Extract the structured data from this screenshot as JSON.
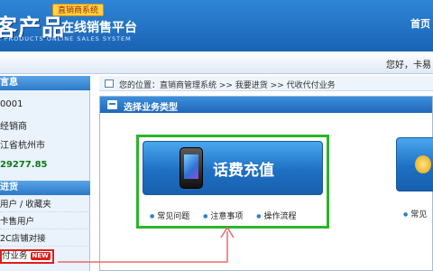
{
  "header": {
    "logo_big": "客产品",
    "logo_title": "在线销售平台",
    "logo_tag": "直销商系统",
    "logo_sub": "L PRODUCTS ONLINE SALES SYSTEM",
    "home_link": "首页"
  },
  "greet_bar": {
    "greeting": "您好，卡易"
  },
  "sidebar": {
    "info_header": "言息",
    "info_rows": [
      "0001",
      "经销商",
      "江省杭州市",
      "29277.85"
    ],
    "menu_header": "进货",
    "menu_items": [
      "用户 / 收藏夹",
      "卡售用户",
      "2C店铺对接",
      "付业务"
    ],
    "new_badge": "NEW"
  },
  "breadcrumb": {
    "text": "您的位置：直销商管理系统  >>  我要进货  >>  代收代付业务"
  },
  "panel": {
    "title": "选择业务类型",
    "card1": {
      "label": "话费充值",
      "links": [
        "常见问题",
        "注意事项",
        "操作流程"
      ]
    },
    "card2": {
      "link": "常见"
    }
  },
  "colors": {
    "header_blue": "#1a62b4",
    "highlight_green": "#2bb52b",
    "highlight_red": "#e21b1b"
  }
}
